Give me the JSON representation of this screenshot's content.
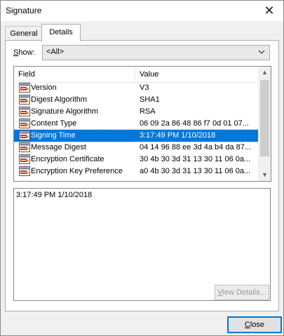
{
  "window": {
    "title": "Signature"
  },
  "tabs": [
    {
      "label": "General"
    },
    {
      "label": "Details"
    }
  ],
  "show": {
    "label_underline": "S",
    "label_rest": "how:",
    "value": "<All>"
  },
  "list": {
    "headers": {
      "field": "Field",
      "value": "Value"
    },
    "rows": [
      {
        "field": "Version",
        "value": "V3"
      },
      {
        "field": "Digest Algorithm",
        "value": "SHA1"
      },
      {
        "field": "Signature Algorithm",
        "value": "RSA"
      },
      {
        "field": "Content Type",
        "value": "06 09 2a 86 48 86 f7 0d 01 07..."
      },
      {
        "field": "Signing Time",
        "value": "3:17:49 PM 1/10/2018"
      },
      {
        "field": "Message Digest",
        "value": "04 14 96 88 ee 3d 4a b4 da 87..."
      },
      {
        "field": "Encryption Certificate",
        "value": "30 4b 30 3d 31 13 30 11 06 0a..."
      },
      {
        "field": "Encryption Key Preference",
        "value": "a0 4b 30 3d 31 13 30 11 06 0a..."
      }
    ],
    "selected_index": 4
  },
  "details": {
    "text": "3:17:49 PM 1/10/2018"
  },
  "buttons": {
    "view_details_underline": "V",
    "view_details_rest": "iew Details...",
    "close_underline": "C",
    "close_rest": "lose"
  }
}
